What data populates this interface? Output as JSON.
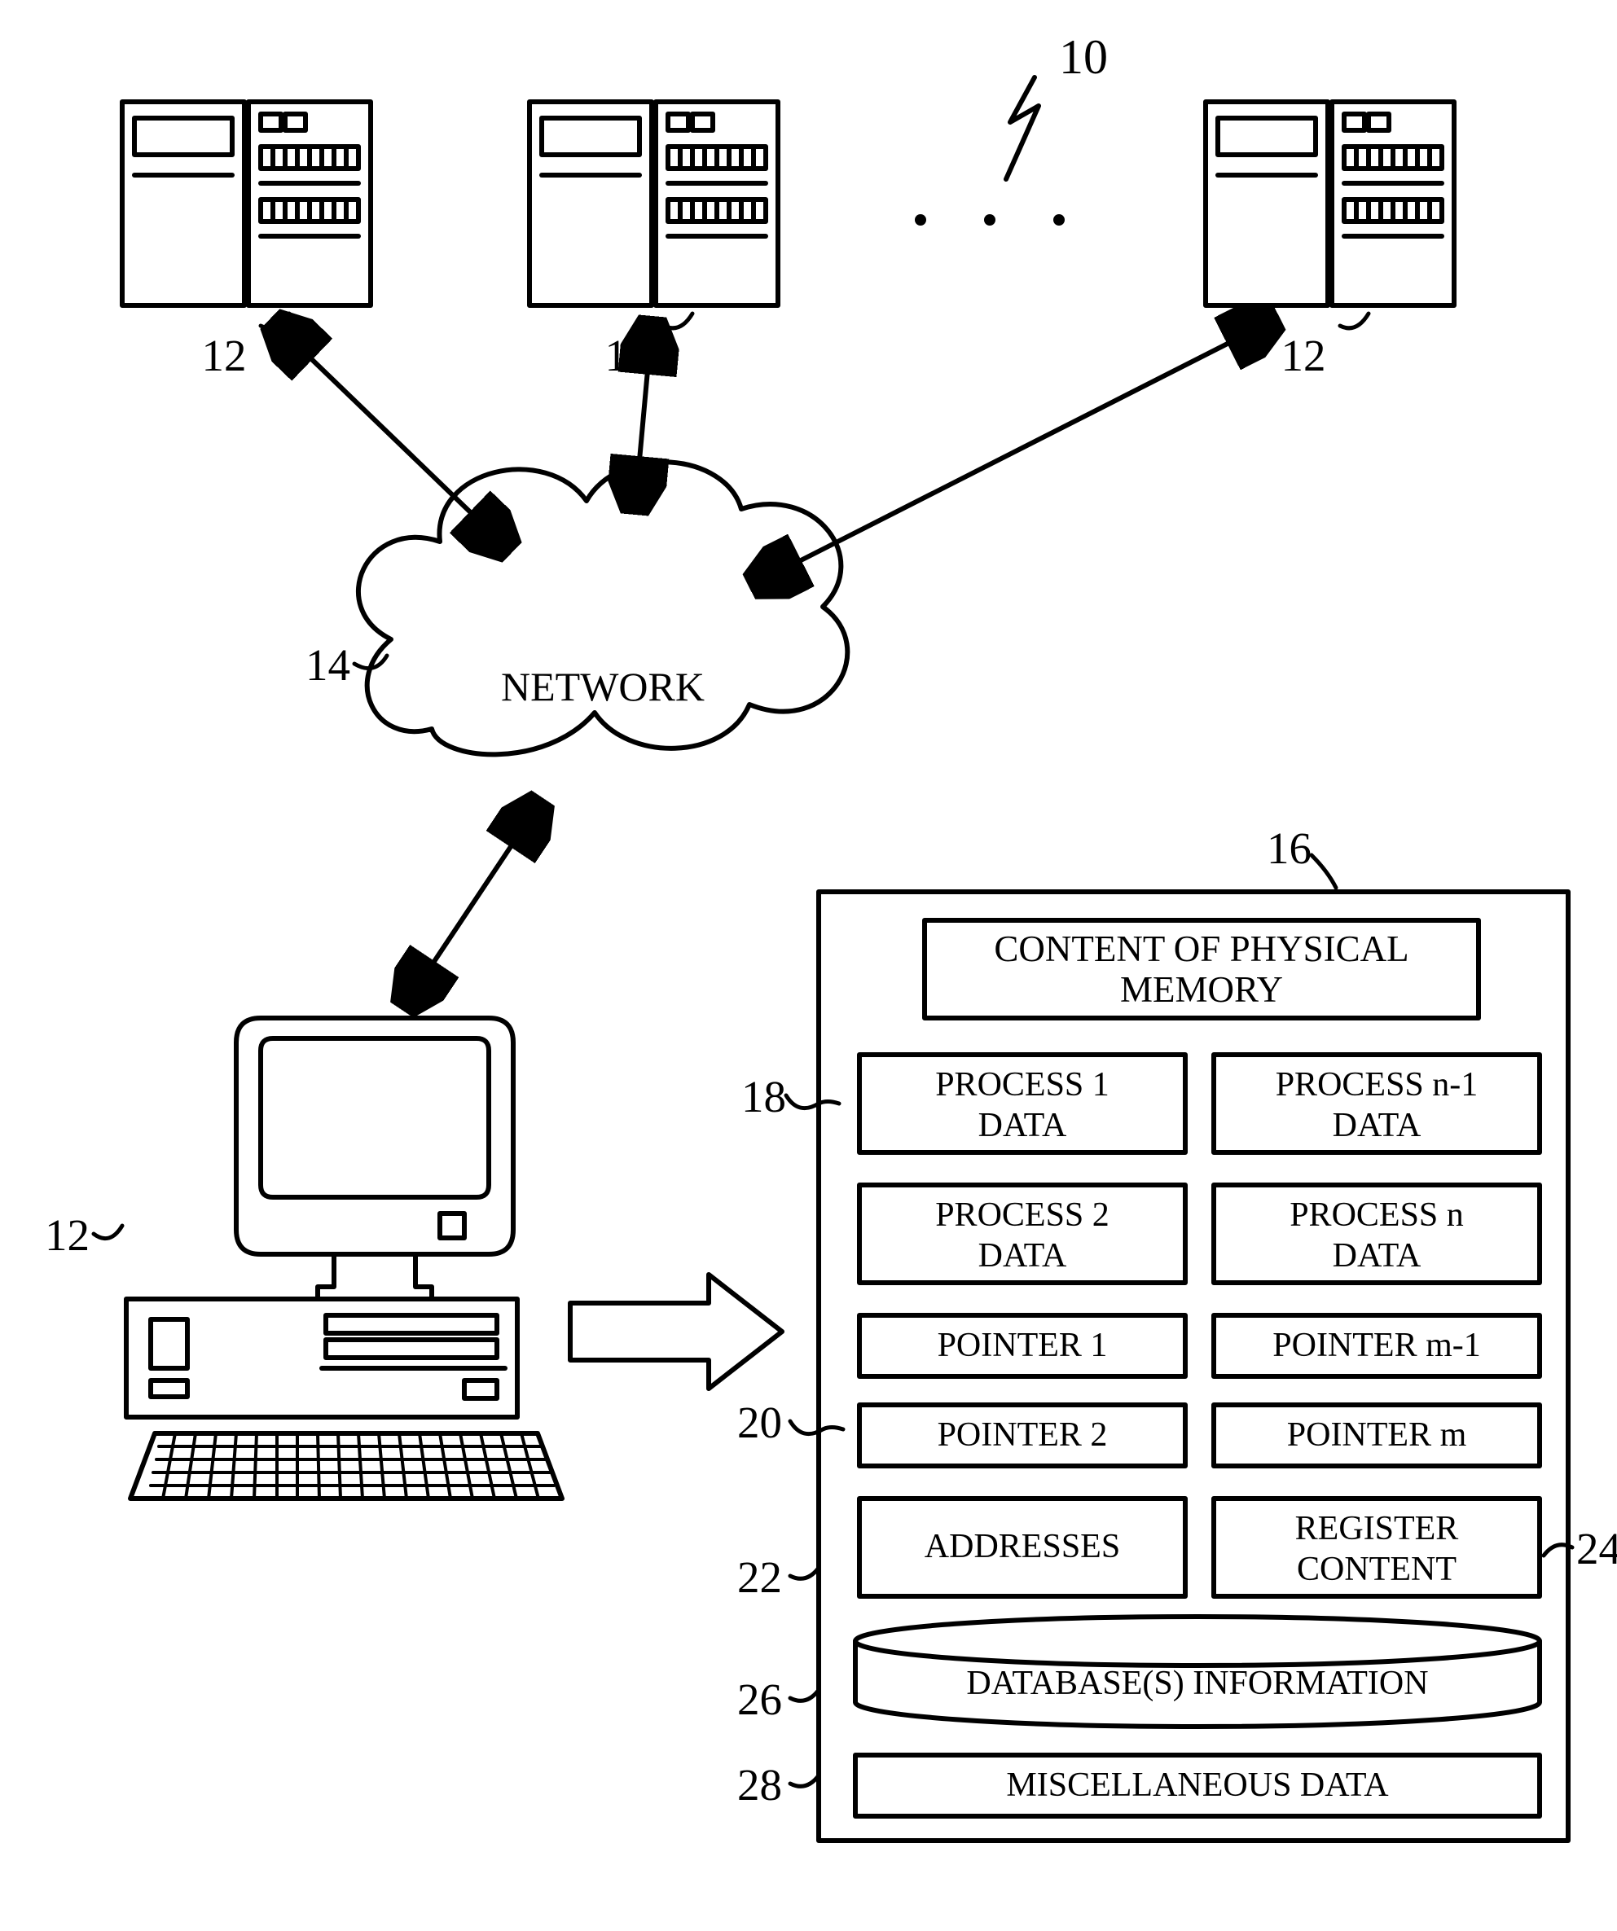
{
  "labels": {
    "ref10": "10",
    "ref12a": "12",
    "ref12b": "12",
    "ref12c": "12",
    "ref12d": "12",
    "ref14": "14",
    "ref16": "16",
    "ref18": "18",
    "ref20": "20",
    "ref22": "22",
    "ref24": "24",
    "ref26": "26",
    "ref28": "28",
    "network": "NETWORK",
    "mem_title_l1": "CONTENT OF PHYSICAL",
    "mem_title_l2": "MEMORY",
    "p1_l1": "PROCESS 1",
    "p1_l2": "DATA",
    "pn1_l1": "PROCESS n-1",
    "pn1_l2": "DATA",
    "p2_l1": "PROCESS 2",
    "p2_l2": "DATA",
    "pn_l1": "PROCESS n",
    "pn_l2": "DATA",
    "ptr1": "POINTER 1",
    "ptrm1": "POINTER m-1",
    "ptr2": "POINTER 2",
    "ptrm": "POINTER m",
    "addr": "ADDRESSES",
    "reg_l1": "REGISTER",
    "reg_l2": "CONTENT",
    "db": "DATABASE(S) INFORMATION",
    "misc": "MISCELLANEOUS DATA"
  }
}
